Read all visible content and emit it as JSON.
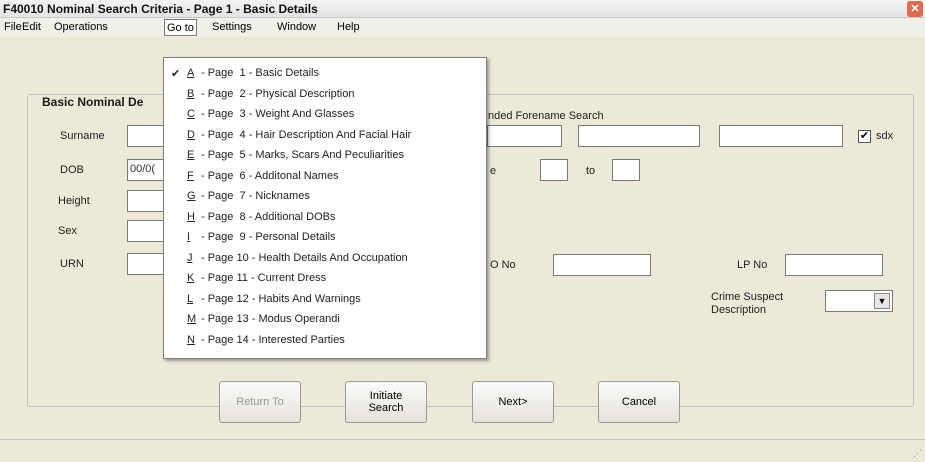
{
  "window": {
    "title": "F40010 Nominal Search Criteria - Page 1 - Basic Details"
  },
  "menu": {
    "file": "File",
    "edit": "Edit",
    "operations": "Operations",
    "goto": "Go to",
    "settings": "Settings",
    "window": "Window",
    "help": "Help"
  },
  "goto_menu": [
    {
      "key": "A",
      "text": "- Page  1 - Basic Details",
      "checked": true
    },
    {
      "key": "B",
      "text": "- Page  2 - Physical Description"
    },
    {
      "key": "C",
      "text": "- Page  3 - Weight And Glasses"
    },
    {
      "key": "D",
      "text": "- Page  4 - Hair Description And Facial Hair"
    },
    {
      "key": "E",
      "text": "- Page  5 - Marks, Scars And Peculiarities"
    },
    {
      "key": "F",
      "text": "- Page  6 - Additonal Names"
    },
    {
      "key": "G",
      "text": "- Page  7 - Nicknames"
    },
    {
      "key": "H",
      "text": "- Page  8 - Additional DOBs"
    },
    {
      "key": "I",
      "text": "- Page  9 - Personal Details"
    },
    {
      "key": "J",
      "text": "- Page 10 - Health Details And Occupation"
    },
    {
      "key": "K",
      "text": "- Page 11 - Current Dress"
    },
    {
      "key": "L",
      "text": "- Page 12 - Habits And Warnings"
    },
    {
      "key": "M",
      "text": "- Page 13 - Modus Operandi"
    },
    {
      "key": "N",
      "text": "- Page 14 - Interested Parties"
    }
  ],
  "form": {
    "group_title": "Basic Nominal De",
    "surname_label": "Surname",
    "dob_label": "DOB",
    "dob_value": "00/0(",
    "height_label": "Height",
    "sex_label": "Sex",
    "urn_label": "URN",
    "extended_forename_label": "nded Forename Search",
    "sdx_label": "sdx",
    "range_label": "e",
    "to_label": "to",
    "o_no_label": "O No",
    "lp_no_label": "LP No",
    "crime_suspect_label_1": "Crime Suspect",
    "crime_suspect_label_2": "Description",
    "sdx_checked": "✔"
  },
  "buttons": {
    "return_to": "Return To",
    "initiate_1": "Initiate",
    "initiate_2": "Search",
    "next": "Next>",
    "cancel": "Cancel"
  },
  "icons": {
    "check": "✔",
    "close": "✕",
    "dropdown_arrow": "▼",
    "grip": "⋰"
  }
}
